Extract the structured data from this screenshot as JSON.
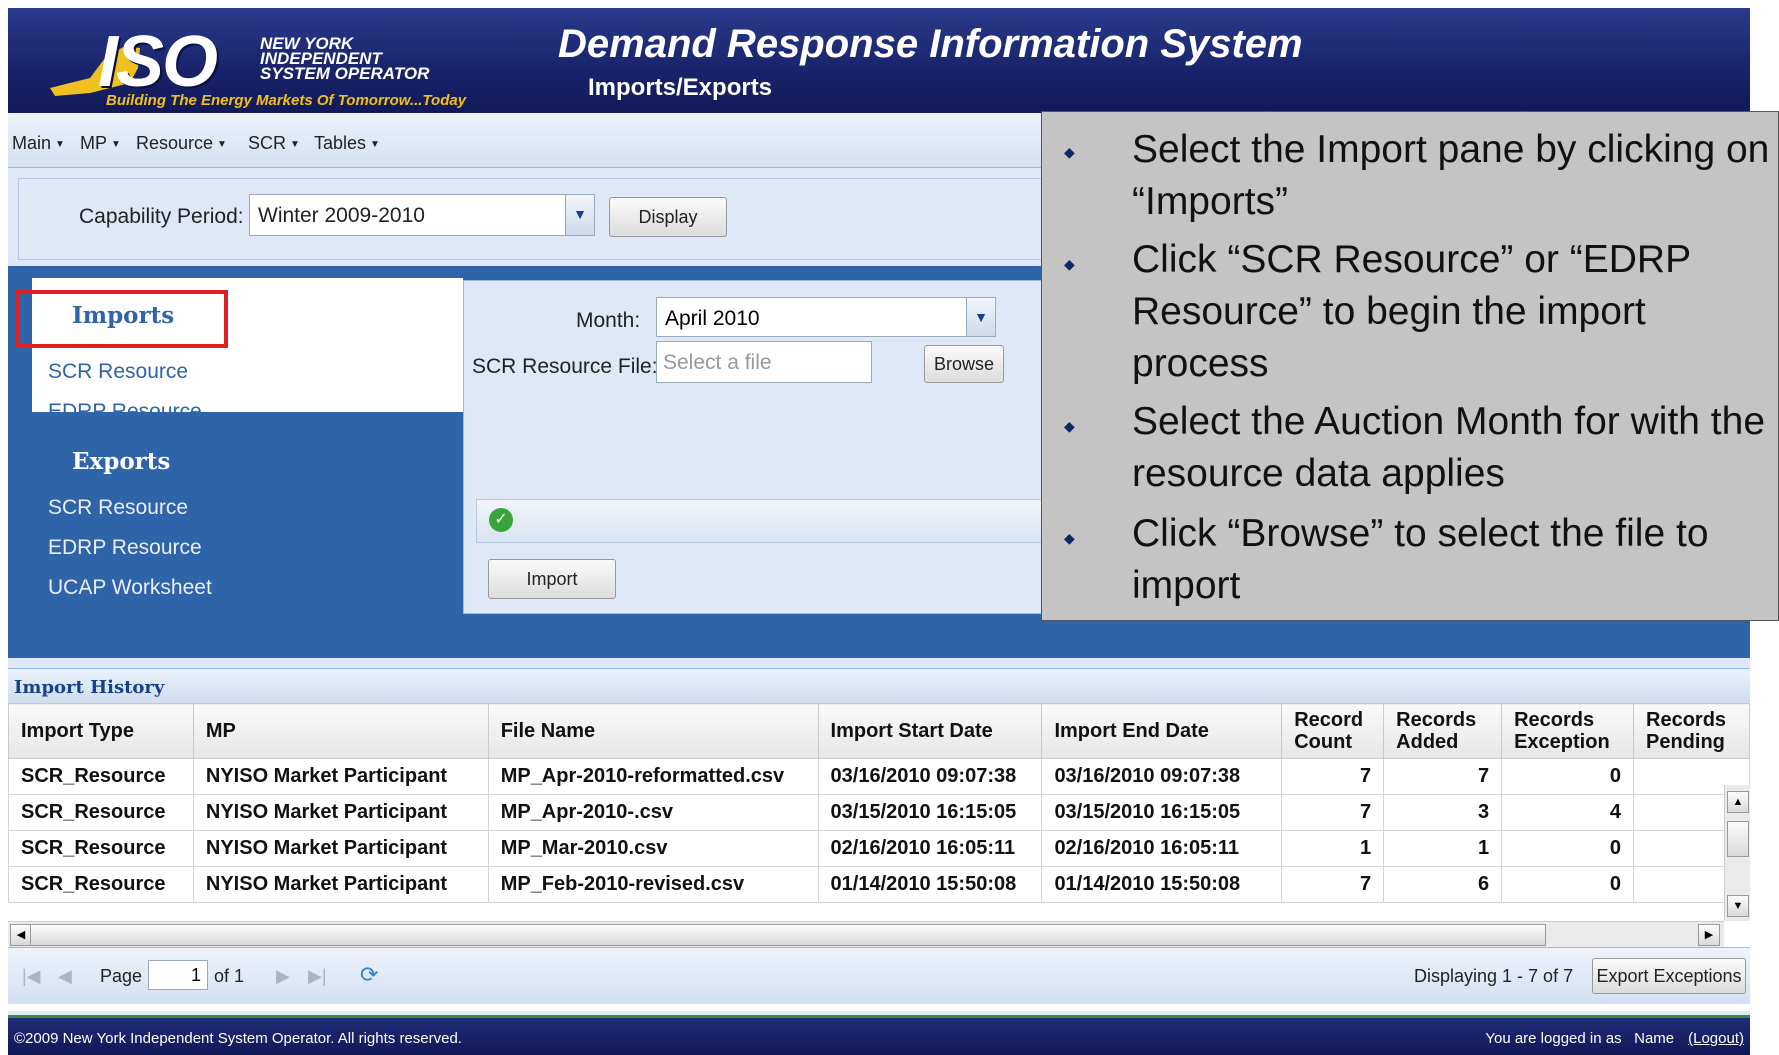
{
  "header": {
    "logo_iso": "ISO",
    "logo_line1": "NEW YORK",
    "logo_line2": "INDEPENDENT",
    "logo_line3": "SYSTEM OPERATOR",
    "logo_tagline": "Building The Energy Markets Of Tomorrow...Today",
    "title": "Demand Response Information System",
    "subtitle": "Imports/Exports"
  },
  "menu": [
    "Main",
    "MP",
    "Resource",
    "SCR",
    "Tables"
  ],
  "capability": {
    "label": "Capability Period:",
    "value": "Winter 2009-2010",
    "display_button": "Display"
  },
  "nav": {
    "imports_title": "Imports",
    "imports_items": [
      "SCR Resource",
      "EDRP Resource"
    ],
    "exports_title": "Exports",
    "exports_items": [
      "SCR Resource",
      "EDRP Resource",
      "UCAP Worksheet"
    ]
  },
  "import_pane": {
    "month_label": "Month:",
    "month_value": "April 2010",
    "file_label": "SCR Resource File:",
    "file_placeholder": "Select a file",
    "browse_button": "Browse",
    "import_button": "Import"
  },
  "history": {
    "title": "Import History",
    "columns": [
      "Import Type",
      "MP",
      "File Name",
      "Import Start Date",
      "Import End Date",
      "Record Count",
      "Records Added",
      "Records Exception",
      "Records Pending"
    ],
    "rows": [
      [
        "SCR_Resource",
        "NYISO Market Participant",
        "MP_Apr-2010-reformatted.csv",
        "03/16/2010 09:07:38",
        "03/16/2010 09:07:38",
        "7",
        "7",
        "0",
        ""
      ],
      [
        "SCR_Resource",
        "NYISO Market Participant",
        "MP_Apr-2010-.csv",
        "03/15/2010 16:15:05",
        "03/15/2010 16:15:05",
        "7",
        "3",
        "4",
        ""
      ],
      [
        "SCR_Resource",
        "NYISO Market Participant",
        "MP_Mar-2010.csv",
        "02/16/2010 16:05:11",
        "02/16/2010 16:05:11",
        "1",
        "1",
        "0",
        ""
      ],
      [
        "SCR_Resource",
        "NYISO Market Participant",
        "MP_Feb-2010-revised.csv",
        "01/14/2010 15:50:08",
        "01/14/2010 15:50:08",
        "7",
        "6",
        "0",
        ""
      ]
    ]
  },
  "paging": {
    "page_label": "Page",
    "page_value": "1",
    "of_label": "of 1",
    "displaying": "Displaying 1 - 7 of 7",
    "export_button": "Export Exceptions"
  },
  "footer": {
    "copyright": "©2009   New York Independent System Operator. All rights reserved.",
    "logged_in": "You are logged in as",
    "user": "Name",
    "logout": "(Logout)"
  },
  "overlay": {
    "bullets": [
      "Select the Import pane by clicking on “Imports”",
      "Click “SCR Resource” or “EDRP Resource” to begin the import process",
      "Select the Auction Month for with the resource data applies",
      "Click “Browse” to select the file to import"
    ]
  },
  "colors": {
    "header": "#18236a",
    "band": "#2f64a8",
    "highlight": "#e02020",
    "overlay": "#c4c4c4"
  }
}
